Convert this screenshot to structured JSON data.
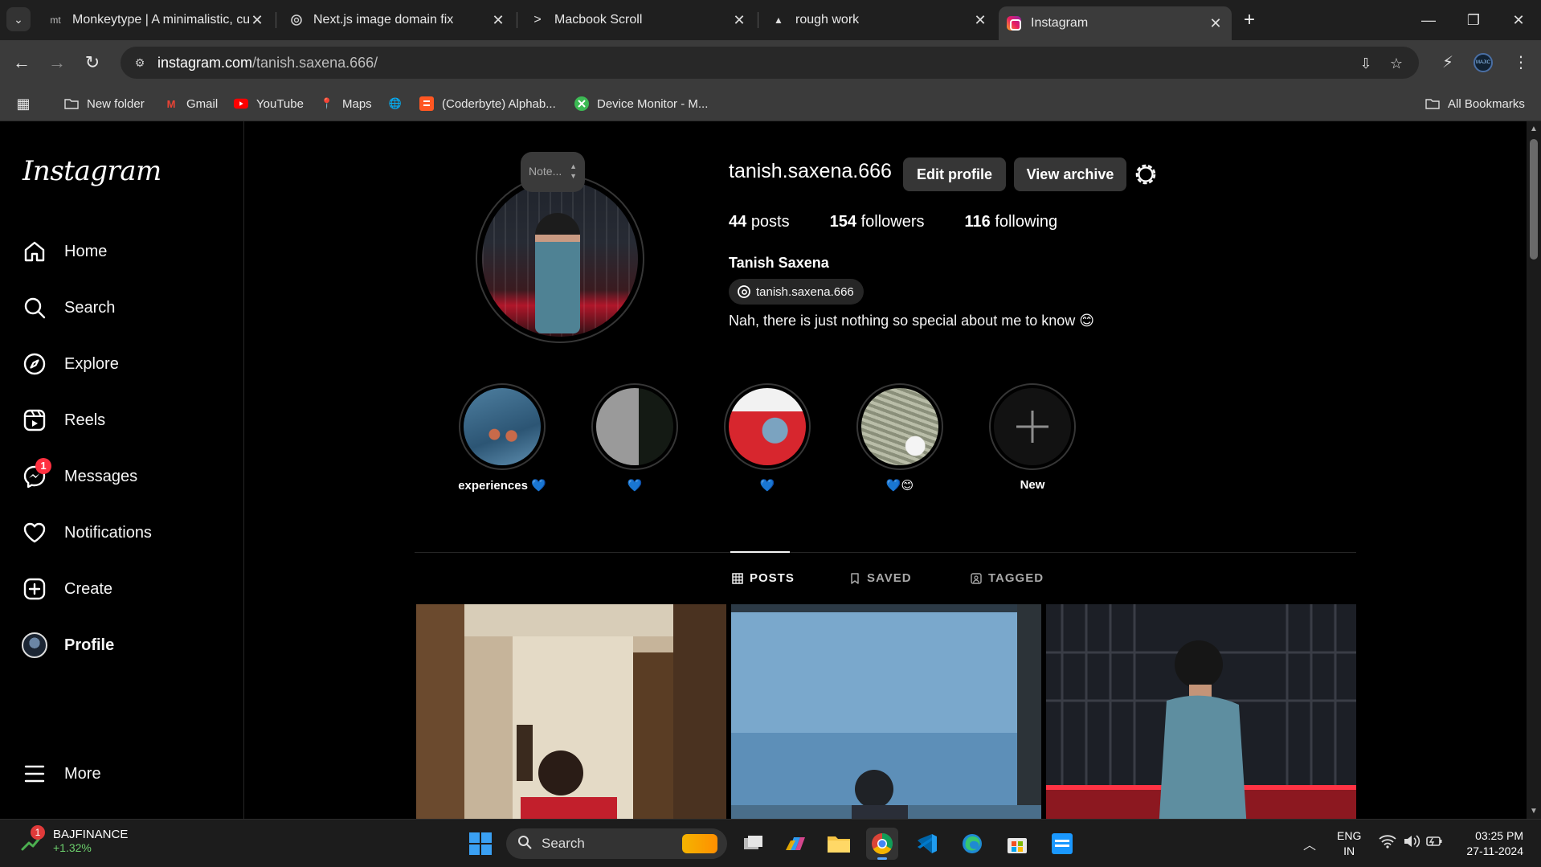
{
  "browser": {
    "tabs": [
      {
        "title": "Monkeytype | A minimalistic, cu",
        "icon": "monkeytype-icon",
        "fav": "mt"
      },
      {
        "title": "Next.js image domain fix",
        "icon": "chatgpt-icon"
      },
      {
        "title": "Macbook Scroll",
        "icon": "terminal-icon"
      },
      {
        "title": "rough work",
        "icon": "drive-icon"
      },
      {
        "title": "Instagram",
        "icon": "instagram-icon"
      }
    ],
    "url_host": "instagram.com",
    "url_path": "/tanish.saxena.666/",
    "bookmarks": [
      {
        "label": "New folder",
        "icon": "folder-icon"
      },
      {
        "label": "Gmail",
        "icon": "gmail-icon"
      },
      {
        "label": "YouTube",
        "icon": "youtube-icon"
      },
      {
        "label": "Maps",
        "icon": "maps-icon"
      },
      {
        "label": "",
        "icon": "globe-icon"
      },
      {
        "label": "(Coderbyte) Alphab...",
        "icon": "blogger-icon"
      },
      {
        "label": "Device Monitor - M...",
        "icon": "device-monitor-icon"
      }
    ],
    "all_bookmarks": "All Bookmarks",
    "profile_badge": "MAJIC"
  },
  "instagram": {
    "logo": "Instagram",
    "nav": [
      {
        "label": "Home",
        "icon": "home-icon"
      },
      {
        "label": "Search",
        "icon": "search-icon"
      },
      {
        "label": "Explore",
        "icon": "compass-icon"
      },
      {
        "label": "Reels",
        "icon": "reels-icon"
      },
      {
        "label": "Messages",
        "icon": "messenger-icon",
        "badge": "1"
      },
      {
        "label": "Notifications",
        "icon": "heart-icon"
      },
      {
        "label": "Create",
        "icon": "plus-square-icon"
      },
      {
        "label": "Profile",
        "icon": "avatar"
      }
    ],
    "more": "More",
    "profile": {
      "note": "Note...",
      "username": "tanish.saxena.666",
      "edit_profile": "Edit profile",
      "view_archive": "View archive",
      "posts_count": "44",
      "posts_label": "posts",
      "followers_count": "154",
      "followers_label": "followers",
      "following_count": "116",
      "following_label": "following",
      "full_name": "Tanish Saxena",
      "threads_handle": "tanish.saxena.666",
      "bio": "Nah, there is just nothing so special about me to know 😊"
    },
    "highlights": [
      {
        "label": "experiences 💙"
      },
      {
        "label": "💙"
      },
      {
        "label": "💙"
      },
      {
        "label": "💙😊"
      },
      {
        "label": "New"
      }
    ],
    "tabs": [
      {
        "label": "POSTS",
        "icon": "grid-icon",
        "active": true
      },
      {
        "label": "SAVED",
        "icon": "bookmark-icon",
        "active": false
      },
      {
        "label": "TAGGED",
        "icon": "tagged-icon",
        "active": false
      }
    ]
  },
  "taskbar": {
    "stock_name": "BAJFINANCE",
    "stock_change": "+1.32%",
    "stock_badge": "1",
    "search_label": "Search",
    "lang_line1": "ENG",
    "lang_line2": "IN",
    "time": "03:25 PM",
    "date": "27-11-2024"
  },
  "colors": {
    "background": "#000000",
    "chrome_dark": "#1f1f1f",
    "chrome_toolbar": "#3b3b3b",
    "button_bg": "#363636",
    "notification_red": "#ff3040"
  }
}
